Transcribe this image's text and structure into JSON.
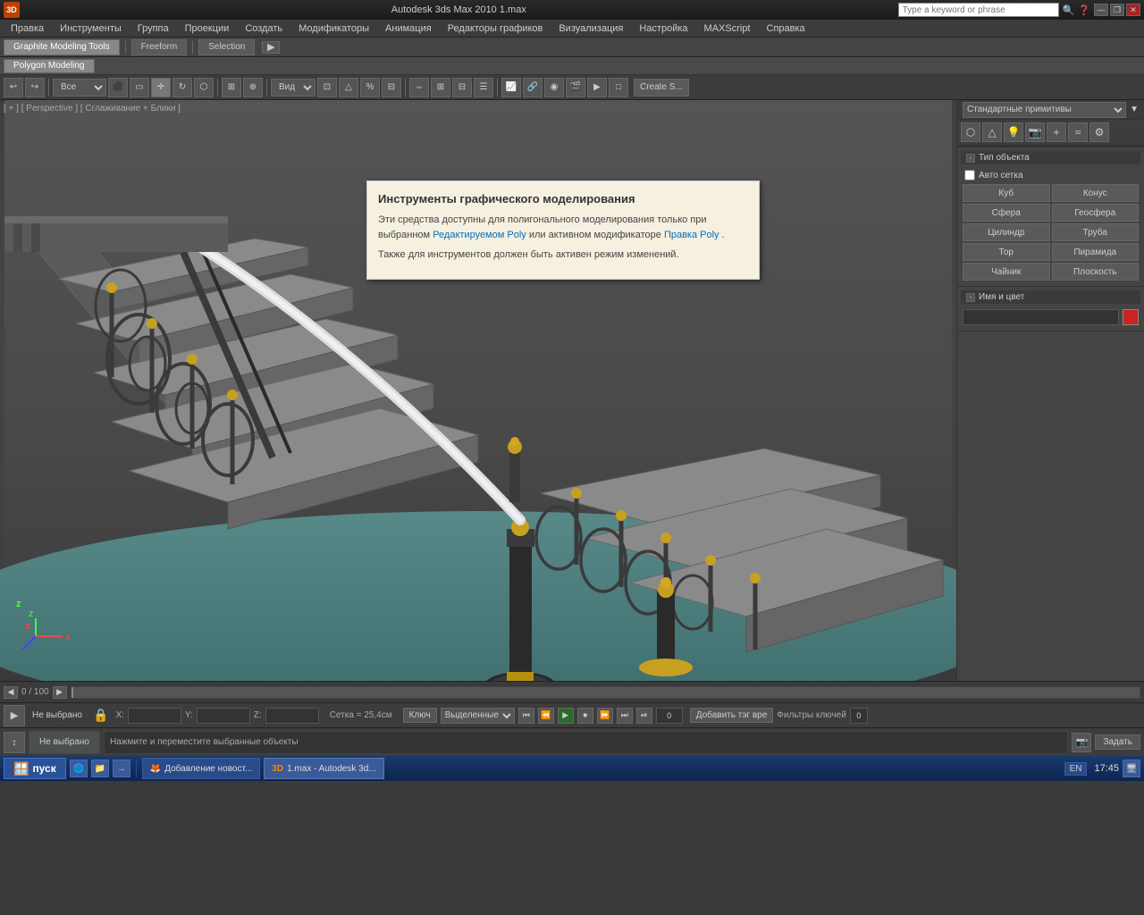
{
  "app": {
    "title": "Autodesk 3ds Max 2010    1.max",
    "logo": "3dsmax-logo"
  },
  "titlebar": {
    "search_placeholder": "Type a keyword or phrase",
    "minimize": "—",
    "maximize": "□",
    "restore": "❐",
    "close": "✕"
  },
  "menubar": {
    "items": [
      "Правка",
      "Инструменты",
      "Группа",
      "Проекции",
      "Создать",
      "Модификаторы",
      "Анимация",
      "Редакторы графиков",
      "Визуализация",
      "Настройка",
      "MAXScript",
      "Справка"
    ]
  },
  "tabbar": {
    "tabs": [
      "Graphite Modeling Tools",
      "Freeform",
      "Selection"
    ],
    "active": "Graphite Modeling Tools"
  },
  "subtabs": {
    "items": [
      "Polygon Modeling"
    ]
  },
  "toolbar2": {
    "dropdown_all": "Все",
    "view_label": "Вид"
  },
  "viewport": {
    "label": "[ + ] [ Perspective ] [ Сглаживание + Блики ]",
    "nav_label": "Вид"
  },
  "tooltip": {
    "title": "Инструменты графического моделирования",
    "body1": "Эти средства доступны для полигонального моделирования только при выбранном",
    "link1": "Редактируемом Poly",
    "body1b": " или активном модификаторе ",
    "link2": "Правка Poly",
    "body1c": ".",
    "body2": "Также для инструментов должен быть активен режим изменений."
  },
  "rightpanel": {
    "dropdown_label": "Стандартные примитивы",
    "section_object_type": "Тип объекта",
    "auto_grid_label": "Авто сетка",
    "buttons": [
      {
        "label": "Куб",
        "id": "btn-cube"
      },
      {
        "label": "Конус",
        "id": "btn-cone"
      },
      {
        "label": "Сфера",
        "id": "btn-sphere"
      },
      {
        "label": "Геосфера",
        "id": "btn-geosphere"
      },
      {
        "label": "Цилиндр",
        "id": "btn-cylinder"
      },
      {
        "label": "Труба",
        "id": "btn-tube"
      },
      {
        "label": "Тор",
        "id": "btn-torus"
      },
      {
        "label": "Пирамида",
        "id": "btn-pyramid"
      },
      {
        "label": "Чайник",
        "id": "btn-teapot"
      },
      {
        "label": "Плоскость",
        "id": "btn-plane"
      }
    ],
    "section_name_color": "Имя и цвет",
    "name_placeholder": "",
    "color": "#cc2222"
  },
  "timeline": {
    "info": "0 / 100",
    "btn_prev": "◀",
    "btn_next": "▶"
  },
  "animbar": {
    "add_key": "Добавить тэг вре",
    "key_label": "Ключ",
    "filters_label": "Фильтры ключей",
    "filters_select": "Выделенные",
    "set_label": "Задать"
  },
  "statusbar": {
    "selected_none": "Не выбрано",
    "hint": "Нажмите и переместите выбранные объекты",
    "x_label": "X:",
    "y_label": "Y:",
    "z_label": "Z:",
    "grid_label": "Сетка = 25,4см"
  },
  "taskbar": {
    "start": "пуск",
    "items": [
      "Добавление новост...",
      "1.max - Autodesk 3d..."
    ],
    "lang": "EN",
    "time": "17:45"
  }
}
